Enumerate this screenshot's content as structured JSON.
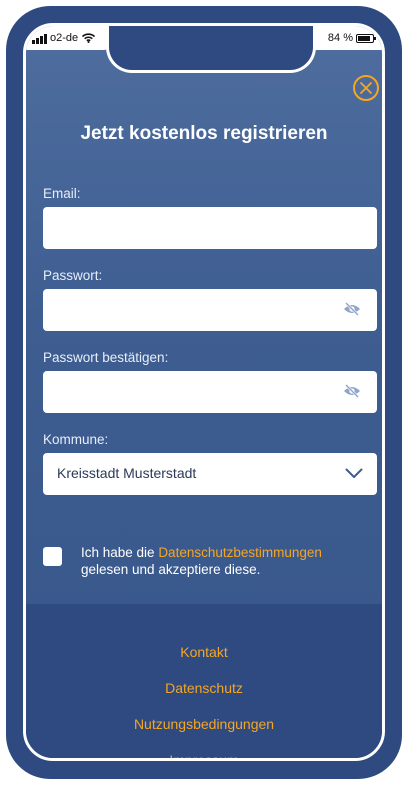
{
  "status_bar": {
    "carrier": "o2-de",
    "battery_text": "84 %",
    "battery_level": 0.84
  },
  "header": {
    "title": "Jetzt kostenlos registrieren",
    "close_icon": "close-circle-icon",
    "accent_color": "#f5a623"
  },
  "form": {
    "email": {
      "label": "Email:",
      "value": ""
    },
    "password": {
      "label": "Passwort:",
      "value": "",
      "icon": "eye-slash-icon"
    },
    "password_confirm": {
      "label": "Passwort bestätigen:",
      "value": "",
      "icon": "eye-slash-icon"
    },
    "municipality": {
      "label": "Kommune:",
      "selected": "Kreisstadt Musterstadt",
      "icon": "chevron-down-icon"
    }
  },
  "consent": {
    "prefix": "Ich habe die ",
    "link": "Datenschutzbestimmungen",
    "suffix": "gelesen und akzeptiere diese.",
    "checked": false
  },
  "footer": {
    "links": [
      "Kontakt",
      "Datenschutz",
      "Nutzungsbedingungen",
      "Impressum"
    ]
  },
  "colors": {
    "background": "#3e5d91",
    "footer": "#2e4a80",
    "accent": "#f5a623"
  }
}
